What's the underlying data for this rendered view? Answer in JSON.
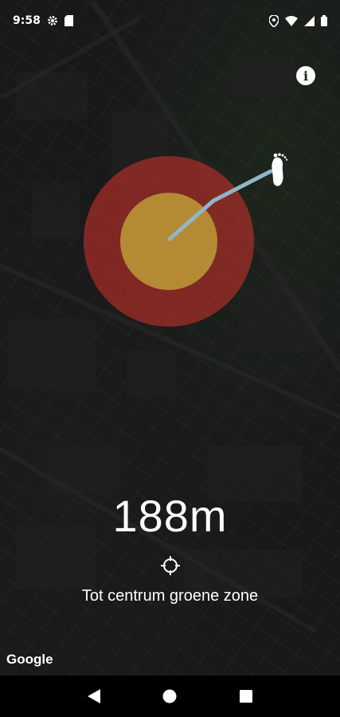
{
  "status_bar": {
    "time": "9:58",
    "left_icons": [
      "settings-gear-icon",
      "sd-card-icon"
    ],
    "right_icons": [
      "location-pin-icon",
      "wifi-icon",
      "cellular-signal-icon",
      "battery-icon"
    ]
  },
  "map": {
    "attribution": "Google",
    "zone_colors": {
      "outer": "#c0302b",
      "inner": "#c8b23a",
      "path": "#8fb6c8"
    }
  },
  "info_button": {
    "icon": "info-icon",
    "label": "i"
  },
  "distance": {
    "value": "188m"
  },
  "caption": {
    "text": "Tot centrum groene zone"
  },
  "nav_bar": {
    "buttons": [
      "back-icon",
      "home-icon",
      "recents-icon"
    ]
  }
}
